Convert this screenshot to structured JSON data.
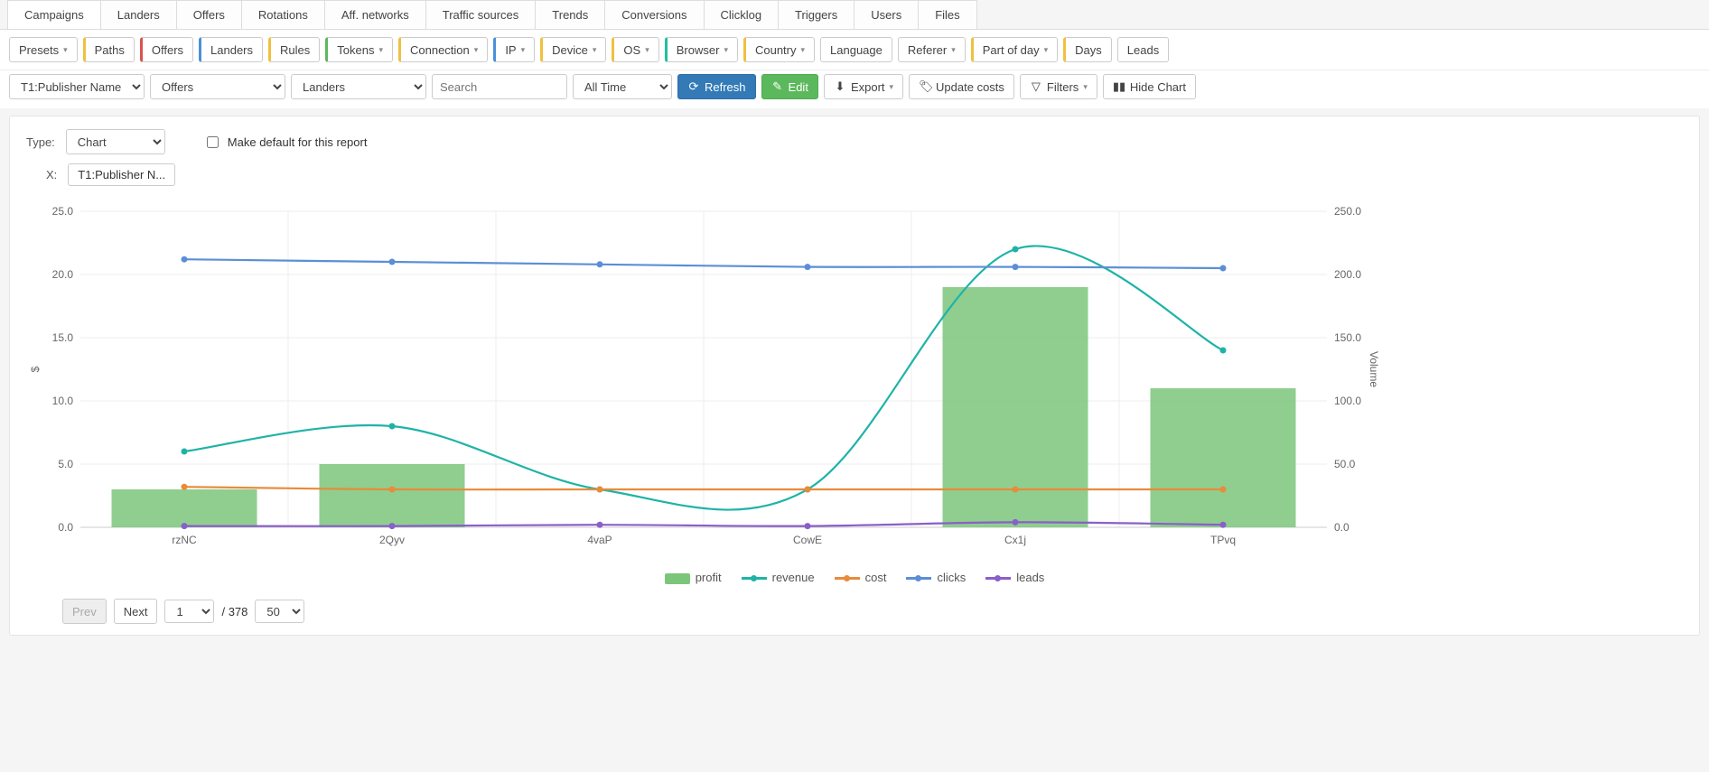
{
  "tabs": [
    "Campaigns",
    "Landers",
    "Offers",
    "Rotations",
    "Aff. networks",
    "Traffic sources",
    "Trends",
    "Conversions",
    "Clicklog",
    "Triggers",
    "Users",
    "Files"
  ],
  "active_tab_index": 0,
  "toolbar": {
    "presets": "Presets",
    "paths": "Paths",
    "offers": "Offers",
    "landers": "Landers",
    "rules": "Rules",
    "tokens": "Tokens",
    "connection": "Connection",
    "ip": "IP",
    "device": "Device",
    "os": "OS",
    "browser": "Browser",
    "country": "Country",
    "language": "Language",
    "referer": "Referer",
    "part_of_day": "Part of day",
    "days": "Days",
    "leads": "Leads"
  },
  "filters": {
    "dim1": "T1:Publisher Name",
    "dim2": "Offers",
    "dim3": "Landers",
    "search_placeholder": "Search",
    "timerange": "All Time",
    "refresh": "Refresh",
    "edit": "Edit",
    "export": "Export",
    "update_costs": "Update costs",
    "filters": "Filters",
    "hide_chart": "Hide Chart"
  },
  "report_header": {
    "type_label": "Type:",
    "type_value": "Chart",
    "default_label": "Make default for this report",
    "x_label": "X:",
    "x_value": "T1:Publisher N..."
  },
  "pager": {
    "prev": "Prev",
    "next": "Next",
    "page": "1",
    "total": "/ 378",
    "page_size": "50"
  },
  "chart_data": {
    "type": "bar+line",
    "categories": [
      "rzNC",
      "2Qyv",
      "4vaP",
      "CowE",
      "Cx1j",
      "TPvq"
    ],
    "ylabel_left": "$",
    "ylabel_right": "Volume",
    "ylim_left": [
      0,
      25
    ],
    "ylim_right": [
      0,
      250
    ],
    "yticks_left": [
      0.0,
      5.0,
      10.0,
      15.0,
      20.0,
      25.0
    ],
    "yticks_right": [
      0.0,
      50.0,
      100.0,
      150.0,
      200.0,
      250.0
    ],
    "series": [
      {
        "name": "profit",
        "kind": "bar",
        "axis": "left",
        "color": "#7bc67b",
        "values": [
          3.0,
          5.0,
          0.0,
          0.0,
          19.0,
          11.0
        ]
      },
      {
        "name": "revenue",
        "kind": "line",
        "axis": "left",
        "color": "#1fb3a7",
        "values": [
          6.0,
          8.0,
          3.0,
          3.0,
          22.0,
          14.0
        ]
      },
      {
        "name": "cost",
        "kind": "line",
        "axis": "left",
        "color": "#e88b3a",
        "values": [
          3.2,
          3.0,
          3.0,
          3.0,
          3.0,
          3.0
        ]
      },
      {
        "name": "clicks",
        "kind": "line",
        "axis": "right",
        "color": "#5a8fd6",
        "values": [
          212,
          210,
          208,
          206,
          206,
          205
        ]
      },
      {
        "name": "leads",
        "kind": "line",
        "axis": "right",
        "color": "#8a5fc9",
        "values": [
          1,
          1,
          2,
          1,
          4,
          2
        ]
      }
    ]
  }
}
